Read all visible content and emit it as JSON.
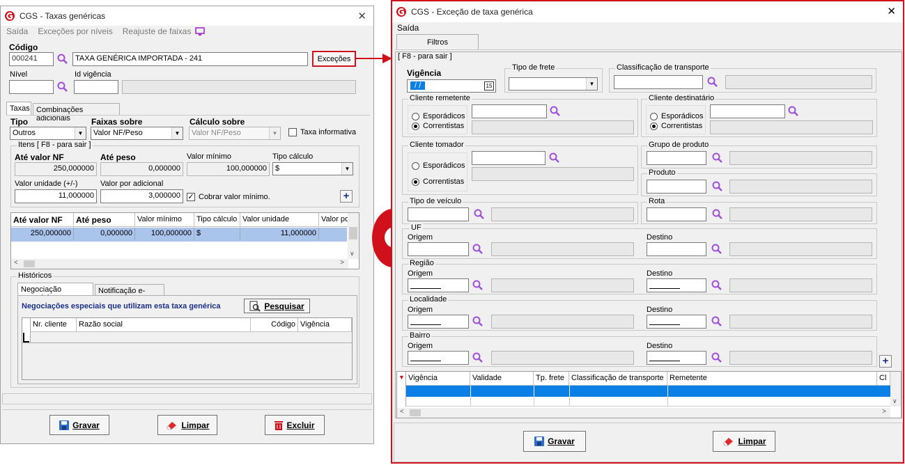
{
  "left": {
    "title": "CGS - Taxas genéricas",
    "menu": [
      "Saída",
      "Exceções por níveis",
      "Reajuste de faixas"
    ],
    "codigo_label": "Código",
    "codigo_value": "000241",
    "descricao_value": "TAXA GENÉRICA IMPORTADA - 241",
    "excecoes_button": "Exceções",
    "nivel_label": "Nível",
    "id_vigencia_label": "Id vigência",
    "tabs": [
      "Taxas",
      "Combinações adicionais"
    ],
    "tipo_label": "Tipo",
    "tipo_value": "Outros",
    "faixas_label": "Faixas sobre",
    "faixas_value": "Valor NF/Peso",
    "calculo_label": "Cálculo sobre",
    "calculo_value": "Valor NF/Peso",
    "taxa_informativa": "Taxa informativa",
    "itens_group": "Itens [ F8 - para sair ]",
    "ate_valor_label": "Até valor NF",
    "ate_valor_value": "250,000000",
    "ate_peso_label": "Até peso",
    "ate_peso_value": "0,000000",
    "valor_minimo_label": "Valor mínimo",
    "valor_minimo_value": "100,000000",
    "tipo_calculo_label": "Tipo cálculo",
    "tipo_calculo_value": "$",
    "valor_unidade_label": "Valor unidade (+/-)",
    "valor_unidade_value": "11,000000",
    "valor_adicional_label": "Valor por adicional",
    "valor_adicional_value": "3,000000",
    "cobrar_minimo": "Cobrar valor mínimo.",
    "grid_headers": [
      "Até valor NF",
      "Até peso",
      "Valor mínimo",
      "Tipo cálculo",
      "Valor unidade",
      "Valor po"
    ],
    "grid_row": [
      "250,000000",
      "0,000000",
      "100,000000",
      "$",
      "11,000000",
      ""
    ],
    "historicos": "Históricos",
    "hist_tabs": [
      "Negociação especial",
      "Notificação e-mails"
    ],
    "negociacoes_title": "Negociações especiais que utilizam esta taxa genérica",
    "pesquisar": "Pesquisar",
    "hist_headers": [
      "Nr. cliente",
      "Razão social",
      "Código",
      "Vigência"
    ],
    "gravar": "Gravar",
    "limpar": "Limpar",
    "excluir": "Excluir"
  },
  "right": {
    "title": "CGS - Exceção de taxa genérica",
    "menu": "Saída",
    "tab": "Filtros",
    "f8": "[ F8 - para sair ]",
    "vigencia_label": "Vigência",
    "vigencia_value": " /  /",
    "tipo_frete": "Tipo de frete",
    "classificacao": "Classificação de transporte",
    "cliente_remetente": "Cliente remetente",
    "cliente_destinatario": "Cliente destinatário",
    "cliente_tomador": "Cliente tomador",
    "esporadicos": "Esporádicos",
    "correntistas": "Correntistas",
    "grupo_produto": "Grupo de produto",
    "produto": "Produto",
    "tipo_veiculo": "Tipo de veículo",
    "rota": "Rota",
    "uf": "UF",
    "regiao": "Região",
    "localidade": "Localidade",
    "bairro": "Bairro",
    "origem": "Origem",
    "destino": "Destino",
    "grid_headers": [
      "Vigência",
      "Validade",
      "Tp. frete",
      "Classificação de transporte",
      "Remetente",
      "Cl"
    ],
    "gravar": "Gravar",
    "limpar": "Limpar"
  },
  "colors": {
    "accent_red": "#d0101a",
    "selection_blue": "#0a7fe6",
    "row_blue": "#aac4ec"
  }
}
